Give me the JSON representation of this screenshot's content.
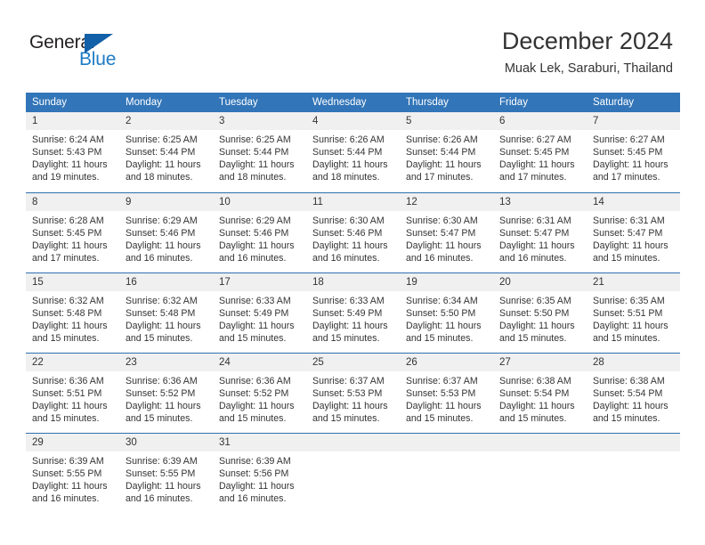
{
  "brand": {
    "name_part1": "General",
    "name_part2": "Blue",
    "colors": {
      "black": "#231f20",
      "blue": "#1e7bc4",
      "triangle": "#1260a8"
    }
  },
  "header": {
    "title": "December 2024",
    "subtitle": "Muak Lek, Saraburi, Thailand"
  },
  "calendar": {
    "accent_header_bg": "#3275b8",
    "divider_color": "#2f6fad",
    "daynum_bg": "#f0f0f0",
    "weekday_headers": [
      "Sunday",
      "Monday",
      "Tuesday",
      "Wednesday",
      "Thursday",
      "Friday",
      "Saturday"
    ],
    "weeks": [
      [
        {
          "day": "1",
          "sunrise": "Sunrise: 6:24 AM",
          "sunset": "Sunset: 5:43 PM",
          "daylight_line1": "Daylight: 11 hours",
          "daylight_line2": "and 19 minutes."
        },
        {
          "day": "2",
          "sunrise": "Sunrise: 6:25 AM",
          "sunset": "Sunset: 5:44 PM",
          "daylight_line1": "Daylight: 11 hours",
          "daylight_line2": "and 18 minutes."
        },
        {
          "day": "3",
          "sunrise": "Sunrise: 6:25 AM",
          "sunset": "Sunset: 5:44 PM",
          "daylight_line1": "Daylight: 11 hours",
          "daylight_line2": "and 18 minutes."
        },
        {
          "day": "4",
          "sunrise": "Sunrise: 6:26 AM",
          "sunset": "Sunset: 5:44 PM",
          "daylight_line1": "Daylight: 11 hours",
          "daylight_line2": "and 18 minutes."
        },
        {
          "day": "5",
          "sunrise": "Sunrise: 6:26 AM",
          "sunset": "Sunset: 5:44 PM",
          "daylight_line1": "Daylight: 11 hours",
          "daylight_line2": "and 17 minutes."
        },
        {
          "day": "6",
          "sunrise": "Sunrise: 6:27 AM",
          "sunset": "Sunset: 5:45 PM",
          "daylight_line1": "Daylight: 11 hours",
          "daylight_line2": "and 17 minutes."
        },
        {
          "day": "7",
          "sunrise": "Sunrise: 6:27 AM",
          "sunset": "Sunset: 5:45 PM",
          "daylight_line1": "Daylight: 11 hours",
          "daylight_line2": "and 17 minutes."
        }
      ],
      [
        {
          "day": "8",
          "sunrise": "Sunrise: 6:28 AM",
          "sunset": "Sunset: 5:45 PM",
          "daylight_line1": "Daylight: 11 hours",
          "daylight_line2": "and 17 minutes."
        },
        {
          "day": "9",
          "sunrise": "Sunrise: 6:29 AM",
          "sunset": "Sunset: 5:46 PM",
          "daylight_line1": "Daylight: 11 hours",
          "daylight_line2": "and 16 minutes."
        },
        {
          "day": "10",
          "sunrise": "Sunrise: 6:29 AM",
          "sunset": "Sunset: 5:46 PM",
          "daylight_line1": "Daylight: 11 hours",
          "daylight_line2": "and 16 minutes."
        },
        {
          "day": "11",
          "sunrise": "Sunrise: 6:30 AM",
          "sunset": "Sunset: 5:46 PM",
          "daylight_line1": "Daylight: 11 hours",
          "daylight_line2": "and 16 minutes."
        },
        {
          "day": "12",
          "sunrise": "Sunrise: 6:30 AM",
          "sunset": "Sunset: 5:47 PM",
          "daylight_line1": "Daylight: 11 hours",
          "daylight_line2": "and 16 minutes."
        },
        {
          "day": "13",
          "sunrise": "Sunrise: 6:31 AM",
          "sunset": "Sunset: 5:47 PM",
          "daylight_line1": "Daylight: 11 hours",
          "daylight_line2": "and 16 minutes."
        },
        {
          "day": "14",
          "sunrise": "Sunrise: 6:31 AM",
          "sunset": "Sunset: 5:47 PM",
          "daylight_line1": "Daylight: 11 hours",
          "daylight_line2": "and 15 minutes."
        }
      ],
      [
        {
          "day": "15",
          "sunrise": "Sunrise: 6:32 AM",
          "sunset": "Sunset: 5:48 PM",
          "daylight_line1": "Daylight: 11 hours",
          "daylight_line2": "and 15 minutes."
        },
        {
          "day": "16",
          "sunrise": "Sunrise: 6:32 AM",
          "sunset": "Sunset: 5:48 PM",
          "daylight_line1": "Daylight: 11 hours",
          "daylight_line2": "and 15 minutes."
        },
        {
          "day": "17",
          "sunrise": "Sunrise: 6:33 AM",
          "sunset": "Sunset: 5:49 PM",
          "daylight_line1": "Daylight: 11 hours",
          "daylight_line2": "and 15 minutes."
        },
        {
          "day": "18",
          "sunrise": "Sunrise: 6:33 AM",
          "sunset": "Sunset: 5:49 PM",
          "daylight_line1": "Daylight: 11 hours",
          "daylight_line2": "and 15 minutes."
        },
        {
          "day": "19",
          "sunrise": "Sunrise: 6:34 AM",
          "sunset": "Sunset: 5:50 PM",
          "daylight_line1": "Daylight: 11 hours",
          "daylight_line2": "and 15 minutes."
        },
        {
          "day": "20",
          "sunrise": "Sunrise: 6:35 AM",
          "sunset": "Sunset: 5:50 PM",
          "daylight_line1": "Daylight: 11 hours",
          "daylight_line2": "and 15 minutes."
        },
        {
          "day": "21",
          "sunrise": "Sunrise: 6:35 AM",
          "sunset": "Sunset: 5:51 PM",
          "daylight_line1": "Daylight: 11 hours",
          "daylight_line2": "and 15 minutes."
        }
      ],
      [
        {
          "day": "22",
          "sunrise": "Sunrise: 6:36 AM",
          "sunset": "Sunset: 5:51 PM",
          "daylight_line1": "Daylight: 11 hours",
          "daylight_line2": "and 15 minutes."
        },
        {
          "day": "23",
          "sunrise": "Sunrise: 6:36 AM",
          "sunset": "Sunset: 5:52 PM",
          "daylight_line1": "Daylight: 11 hours",
          "daylight_line2": "and 15 minutes."
        },
        {
          "day": "24",
          "sunrise": "Sunrise: 6:36 AM",
          "sunset": "Sunset: 5:52 PM",
          "daylight_line1": "Daylight: 11 hours",
          "daylight_line2": "and 15 minutes."
        },
        {
          "day": "25",
          "sunrise": "Sunrise: 6:37 AM",
          "sunset": "Sunset: 5:53 PM",
          "daylight_line1": "Daylight: 11 hours",
          "daylight_line2": "and 15 minutes."
        },
        {
          "day": "26",
          "sunrise": "Sunrise: 6:37 AM",
          "sunset": "Sunset: 5:53 PM",
          "daylight_line1": "Daylight: 11 hours",
          "daylight_line2": "and 15 minutes."
        },
        {
          "day": "27",
          "sunrise": "Sunrise: 6:38 AM",
          "sunset": "Sunset: 5:54 PM",
          "daylight_line1": "Daylight: 11 hours",
          "daylight_line2": "and 15 minutes."
        },
        {
          "day": "28",
          "sunrise": "Sunrise: 6:38 AM",
          "sunset": "Sunset: 5:54 PM",
          "daylight_line1": "Daylight: 11 hours",
          "daylight_line2": "and 15 minutes."
        }
      ],
      [
        {
          "day": "29",
          "sunrise": "Sunrise: 6:39 AM",
          "sunset": "Sunset: 5:55 PM",
          "daylight_line1": "Daylight: 11 hours",
          "daylight_line2": "and 16 minutes."
        },
        {
          "day": "30",
          "sunrise": "Sunrise: 6:39 AM",
          "sunset": "Sunset: 5:55 PM",
          "daylight_line1": "Daylight: 11 hours",
          "daylight_line2": "and 16 minutes."
        },
        {
          "day": "31",
          "sunrise": "Sunrise: 6:39 AM",
          "sunset": "Sunset: 5:56 PM",
          "daylight_line1": "Daylight: 11 hours",
          "daylight_line2": "and 16 minutes."
        },
        {
          "day": "",
          "sunrise": "",
          "sunset": "",
          "daylight_line1": "",
          "daylight_line2": ""
        },
        {
          "day": "",
          "sunrise": "",
          "sunset": "",
          "daylight_line1": "",
          "daylight_line2": ""
        },
        {
          "day": "",
          "sunrise": "",
          "sunset": "",
          "daylight_line1": "",
          "daylight_line2": ""
        },
        {
          "day": "",
          "sunrise": "",
          "sunset": "",
          "daylight_line1": "",
          "daylight_line2": ""
        }
      ]
    ]
  }
}
